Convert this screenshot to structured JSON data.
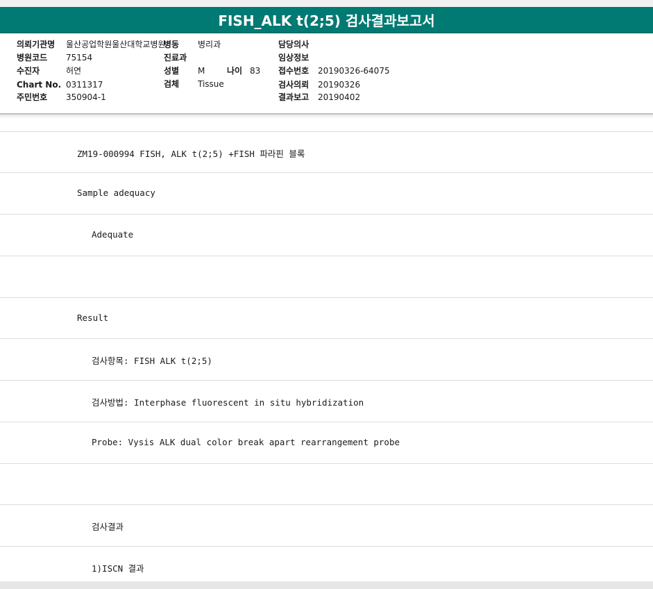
{
  "title": "FISH_ALK t(2;5) 검사결과보고서",
  "header": {
    "institution_label": "의뢰기관명",
    "institution_value": "울산공업학원울산대학교병원",
    "ward_label": "병동",
    "ward_value": "병리과",
    "doctor_label": "담당의사",
    "doctor_value": "",
    "hospital_code_label": "병원코드",
    "hospital_code_value": "75154",
    "dept_label": "진료과",
    "dept_value": "",
    "clinical_label": "임상정보",
    "clinical_value": "",
    "patient_label": "수진자",
    "patient_value": "허연",
    "sex_label": "성별",
    "sex_value": "M",
    "age_label": "나이",
    "age_value": "83",
    "receipt_label": "접수번호",
    "receipt_value": "20190326-64075",
    "chart_label": "Chart No.",
    "chart_value": "0311317",
    "specimen_label": "검체",
    "specimen_value": "Tissue",
    "request_label": "검사의뢰",
    "request_value": "20190326",
    "id_label": "주민번호",
    "id_value": "350904-1",
    "report_label": "결과보고",
    "report_value": "20190402"
  },
  "rows": [
    {
      "text": "ZM19-000994     FISH, ALK t(2;5) +FISH 파라핀 블록"
    },
    {
      "text": "Sample adequacy"
    },
    {
      "text": "Adequate"
    },
    {
      "text": ""
    },
    {
      "text": "Result"
    },
    {
      "text": "검사항목: FISH ALK t(2;5)"
    },
    {
      "text": "검사방법: Interphase fluorescent in situ hybridization"
    },
    {
      "text": "Probe: Vysis ALK dual color break apart rearrangement probe"
    },
    {
      "text": ""
    },
    {
      "text": "검사결과"
    },
    {
      "text": "1)ISCN 결과"
    }
  ]
}
